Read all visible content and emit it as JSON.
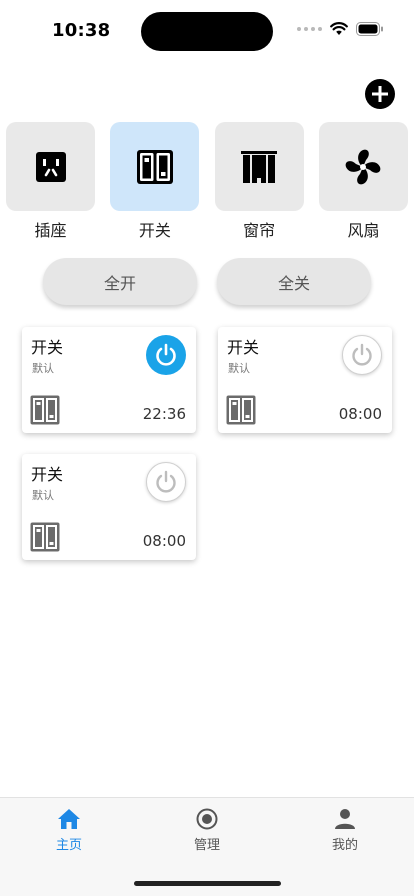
{
  "status_bar": {
    "time": "10:38"
  },
  "categories": [
    {
      "label": "插座",
      "icon": "socket-icon",
      "active": false
    },
    {
      "label": "开关",
      "icon": "switch-icon",
      "active": true
    },
    {
      "label": "窗帘",
      "icon": "curtain-icon",
      "active": false
    },
    {
      "label": "风扇",
      "icon": "fan-icon",
      "active": false
    }
  ],
  "actions": {
    "all_on_label": "全开",
    "all_off_label": "全关"
  },
  "devices": [
    {
      "name": "开关",
      "group": "默认",
      "time": "22:36",
      "power": "on"
    },
    {
      "name": "开关",
      "group": "默认",
      "time": "08:00",
      "power": "off"
    },
    {
      "name": "开关",
      "group": "默认",
      "time": "08:00",
      "power": "off"
    }
  ],
  "colors": {
    "accent": "#1e88e5",
    "power_on": "#1aa3e8",
    "active_category_bg": "#cfe6fa",
    "inactive_category_bg": "#e9e9e9"
  },
  "bottom_nav": [
    {
      "label": "主页",
      "icon": "home-icon",
      "active": true
    },
    {
      "label": "管理",
      "icon": "manage-icon",
      "active": false
    },
    {
      "label": "我的",
      "icon": "profile-icon",
      "active": false
    }
  ]
}
